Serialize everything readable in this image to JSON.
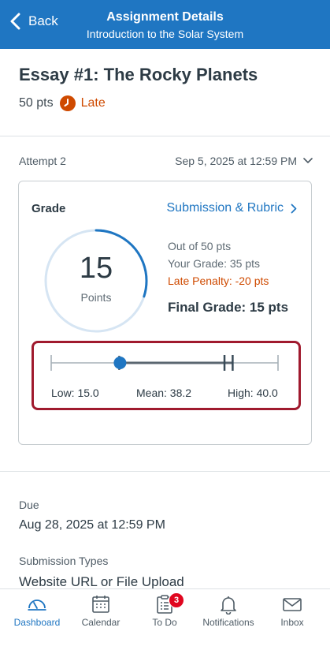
{
  "nav": {
    "back_label": "Back",
    "title": "Assignment Details",
    "subtitle": "Introduction to the Solar System"
  },
  "assignment": {
    "title": "Essay #1: The Rocky Planets",
    "points": "50 pts",
    "status": "Late"
  },
  "attempt": {
    "label": "Attempt 2",
    "date": "Sep 5, 2025 at 12:59 PM"
  },
  "grade": {
    "label": "Grade",
    "rubric_link": "Submission & Rubric",
    "score": "15",
    "score_unit": "Points",
    "score_fraction": 0.3,
    "out_of": "Out of 50 pts",
    "your_grade": "Your Grade: 35 pts",
    "late_penalty": "Late Penalty: -20 pts",
    "final_grade": "Final Grade: 15 pts"
  },
  "stats": {
    "low_label": "Low: 15.0",
    "mean_label": "Mean: 38.2",
    "high_label": "High: 40.0",
    "min": 0,
    "max": 50,
    "low": 15.0,
    "mean": 38.2,
    "high": 40.0,
    "your_score": 15
  },
  "details": {
    "due_label": "Due",
    "due_value": "Aug 28, 2025 at 12:59 PM",
    "submission_types_label": "Submission Types",
    "submission_types_value": "Website URL or File Upload"
  },
  "tabs": [
    {
      "label": "Dashboard",
      "icon": "dashboard-icon",
      "active": true
    },
    {
      "label": "Calendar",
      "icon": "calendar-icon",
      "active": false
    },
    {
      "label": "To Do",
      "icon": "todo-icon",
      "active": false,
      "badge": "3"
    },
    {
      "label": "Notifications",
      "icon": "bell-icon",
      "active": false
    },
    {
      "label": "Inbox",
      "icon": "mail-icon",
      "active": false
    }
  ],
  "colors": {
    "brand": "#1f76c2",
    "late": "#cf4a00",
    "highlight_border": "#a01a2e",
    "badge": "#e0061f"
  }
}
